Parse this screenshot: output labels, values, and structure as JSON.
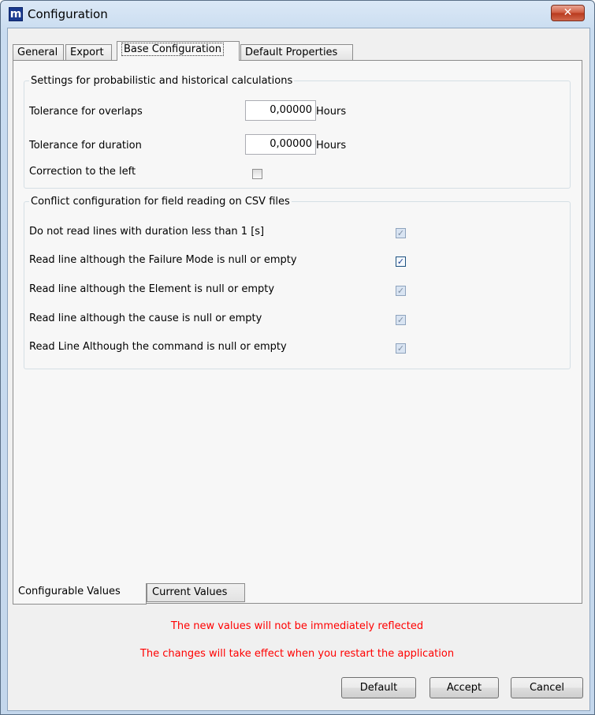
{
  "window": {
    "app_icon_letter": "m",
    "title": "Configuration",
    "close_glyph": "✕"
  },
  "tabs": [
    "General",
    "Export",
    "Base Configuration",
    "Default Properties"
  ],
  "active_tab": "Base Configuration",
  "probabilistic_group": {
    "title": "Settings for probabilistic and historical calculations",
    "tolerance_overlaps_label": "Tolerance for overlaps",
    "tolerance_overlaps_value": "0,00000",
    "tolerance_overlaps_unit": "Hours",
    "tolerance_duration_label": "Tolerance for duration",
    "tolerance_duration_value": "0,00000",
    "tolerance_duration_unit": "Hours",
    "correction_left_label": "Correction to the left",
    "correction_left_checked": false
  },
  "csv_group": {
    "title": "Conflict configuration for field reading on CSV files",
    "options": [
      {
        "label": "Do not read lines with duration less than 1 [s]",
        "checked": true
      },
      {
        "label": "Read line although the Failure Mode is null or empty",
        "checked": true
      },
      {
        "label": "Read line although the Element is null or empty",
        "checked": true
      },
      {
        "label": "Read line although the cause is null or empty",
        "checked": true
      },
      {
        "label": "Read Line Although the command is null or empty",
        "checked": true
      }
    ]
  },
  "bottom_tabs": [
    "Configurable Values",
    "Current Values"
  ],
  "messages": {
    "line1": "The new values will not be immediately reflected",
    "line2": "The changes will take effect when you restart the application"
  },
  "buttons": {
    "default": "Default",
    "accept": "Accept",
    "cancel": "Cancel"
  },
  "colors": {
    "message": "#ff0000",
    "title_bar": "#c9dcf0",
    "close_button": "#c9472a"
  }
}
